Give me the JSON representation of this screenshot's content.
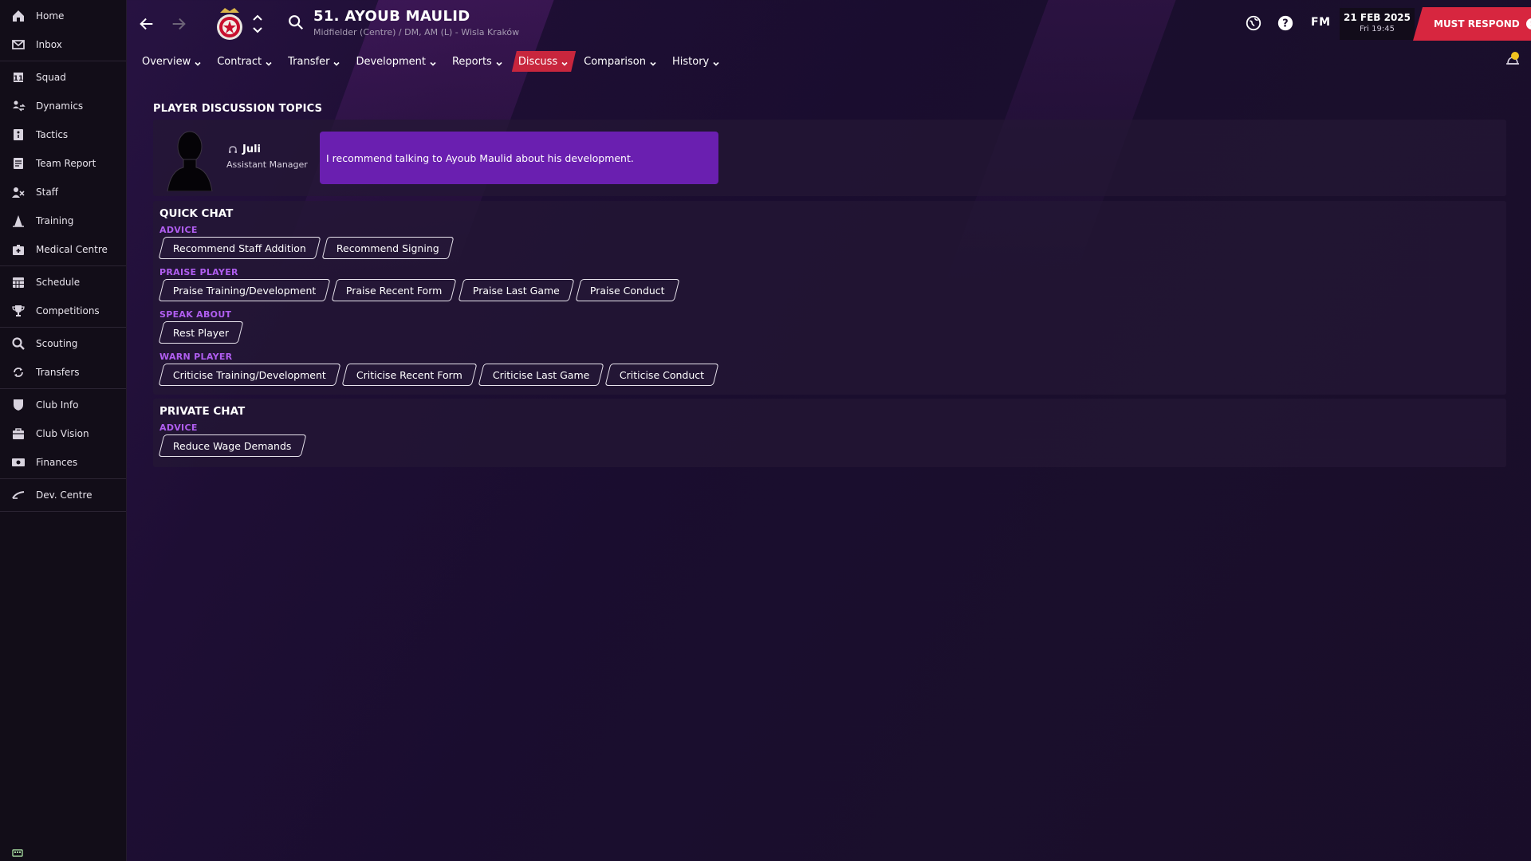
{
  "sidebar": {
    "groups": [
      [
        {
          "label": "Home",
          "icon": "home-icon"
        },
        {
          "label": "Inbox",
          "icon": "inbox-icon"
        }
      ],
      [
        {
          "label": "Squad",
          "icon": "squad-icon"
        },
        {
          "label": "Dynamics",
          "icon": "dynamics-icon"
        },
        {
          "label": "Tactics",
          "icon": "tactics-icon"
        },
        {
          "label": "Team Report",
          "icon": "team-report-icon"
        },
        {
          "label": "Staff",
          "icon": "staff-icon"
        },
        {
          "label": "Training",
          "icon": "training-icon"
        },
        {
          "label": "Medical Centre",
          "icon": "medical-centre-icon"
        }
      ],
      [
        {
          "label": "Schedule",
          "icon": "schedule-icon"
        },
        {
          "label": "Competitions",
          "icon": "trophy-icon"
        }
      ],
      [
        {
          "label": "Scouting",
          "icon": "scouting-icon"
        },
        {
          "label": "Transfers",
          "icon": "transfers-icon"
        }
      ],
      [
        {
          "label": "Club Info",
          "icon": "club-info-icon"
        },
        {
          "label": "Club Vision",
          "icon": "club-vision-icon"
        },
        {
          "label": "Finances",
          "icon": "finances-icon"
        }
      ],
      [
        {
          "label": "Dev. Centre",
          "icon": "dev-centre-icon"
        }
      ]
    ]
  },
  "header": {
    "player_title": "51. AYOUB MAULID",
    "player_subtitle": "Midfielder (Centre) / DM, AM (L) - Wisla Kraków",
    "fm_label": "FM",
    "date": "21 FEB 2025",
    "time": "Fri 19:45",
    "must_respond": "MUST RESPOND",
    "alert_glyph": "!"
  },
  "tabs": [
    {
      "label": "Overview",
      "active": false
    },
    {
      "label": "Contract",
      "active": false
    },
    {
      "label": "Transfer",
      "active": false
    },
    {
      "label": "Development",
      "active": false
    },
    {
      "label": "Reports",
      "active": false
    },
    {
      "label": "Discuss",
      "active": true
    },
    {
      "label": "Comparison",
      "active": false
    },
    {
      "label": "History",
      "active": false
    }
  ],
  "content": {
    "title": "PLAYER DISCUSSION TOPICS",
    "advisor": {
      "name": "Juli",
      "role": "Assistant Manager",
      "message": "I recommend talking to Ayoub Maulid about his development."
    },
    "quick_chat": {
      "title": "QUICK CHAT",
      "categories": [
        {
          "label": "ADVICE",
          "chips": [
            "Recommend Staff Addition",
            "Recommend Signing"
          ]
        },
        {
          "label": "PRAISE PLAYER",
          "chips": [
            "Praise Training/Development",
            "Praise Recent Form",
            "Praise Last Game",
            "Praise Conduct"
          ]
        },
        {
          "label": "SPEAK ABOUT",
          "chips": [
            "Rest Player"
          ]
        },
        {
          "label": "WARN PLAYER",
          "chips": [
            "Criticise Training/Development",
            "Criticise Recent Form",
            "Criticise Last Game",
            "Criticise Conduct"
          ]
        }
      ]
    },
    "private_chat": {
      "title": "PRIVATE CHAT",
      "categories": [
        {
          "label": "ADVICE",
          "chips": [
            "Reduce Wage Demands"
          ]
        }
      ]
    }
  },
  "colors": {
    "accent_red": "#d7263f",
    "active_tab": "#c8263d",
    "bubble_purple": "#6a1fb0",
    "category_purple": "#b05ef0",
    "sidebar_bg": "#120d18"
  }
}
